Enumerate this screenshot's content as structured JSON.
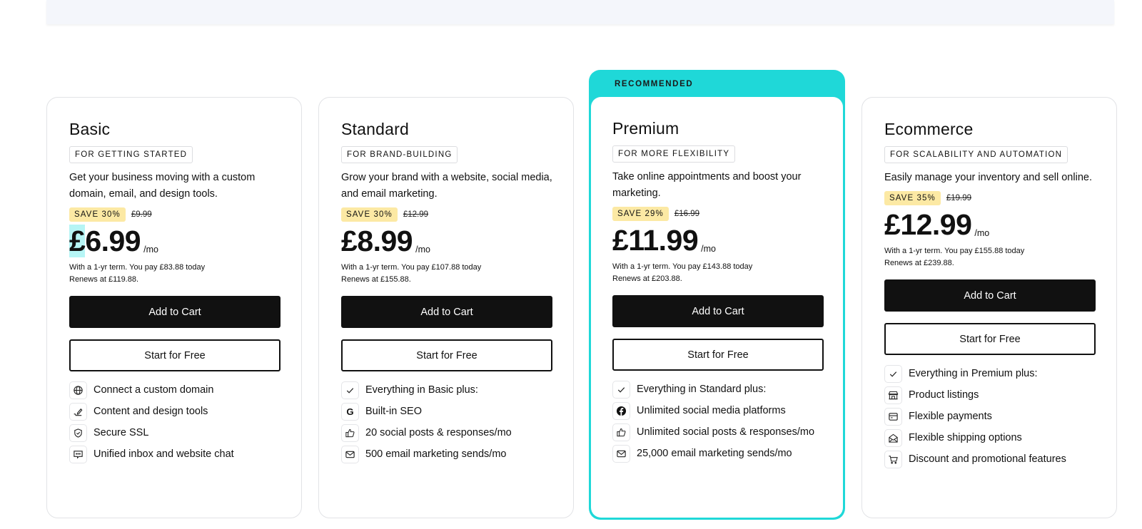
{
  "colors": {
    "recommended_accent": "#1fd8d8",
    "save_badge_bg": "#fce9a4",
    "primary_button_bg": "#111111",
    "price_highlight": "#b6f5f5"
  },
  "plans": [
    {
      "title": "Basic",
      "tag": "FOR GETTING STARTED",
      "description": "Get your business moving with a custom domain, email, and design tools.",
      "save": "SAVE 30%",
      "old_price": "£9.99",
      "price_symbol": "£",
      "price_amount": "6.99",
      "per": "/mo",
      "terms_line1": "With a 1-yr term. You pay £83.88 today",
      "terms_line2": "Renews at £119.88.",
      "add_to_cart": "Add to Cart",
      "start_free": "Start for Free",
      "features": [
        {
          "icon": "globe-icon",
          "text": "Connect a custom domain"
        },
        {
          "icon": "pen-icon",
          "text": "Content and design tools"
        },
        {
          "icon": "shield-check-icon",
          "text": "Secure SSL"
        },
        {
          "icon": "chat-icon",
          "text": "Unified inbox and website chat"
        }
      ]
    },
    {
      "title": "Standard",
      "tag": "FOR BRAND-BUILDING",
      "description": "Grow your brand with a website, social media, and email marketing.",
      "save": "SAVE 30%",
      "old_price": "£12.99",
      "price_symbol": "£",
      "price_amount": "8.99",
      "per": "/mo",
      "terms_line1": "With a 1-yr term. You pay £107.88 today",
      "terms_line2": "Renews at £155.88.",
      "add_to_cart": "Add to Cart",
      "start_free": "Start for Free",
      "features": [
        {
          "icon": "check-icon",
          "text": "Everything in Basic plus:"
        },
        {
          "icon": "google-icon",
          "text": "Built-in SEO"
        },
        {
          "icon": "thumbs-up-icon",
          "text": "20 social posts & responses/mo"
        },
        {
          "icon": "mail-icon",
          "text": "500 email marketing sends/mo"
        }
      ]
    },
    {
      "recommended_label": "RECOMMENDED",
      "title": "Premium",
      "tag": "FOR MORE FLEXIBILITY",
      "description": "Take online appointments and boost your marketing.",
      "save": "SAVE 29%",
      "old_price": "£16.99",
      "price_symbol": "£",
      "price_amount": "11.99",
      "per": "/mo",
      "terms_line1": "With a 1-yr term. You pay £143.88 today",
      "terms_line2": "Renews at £203.88.",
      "add_to_cart": "Add to Cart",
      "start_free": "Start for Free",
      "features": [
        {
          "icon": "check-icon",
          "text": "Everything in Standard plus:"
        },
        {
          "icon": "facebook-icon",
          "text": "Unlimited social media platforms"
        },
        {
          "icon": "thumbs-up-icon",
          "text": "Unlimited social posts & responses/mo"
        },
        {
          "icon": "mail-icon",
          "text": "25,000 email marketing sends/mo"
        }
      ]
    },
    {
      "title": "Ecommerce",
      "tag": "FOR SCALABILITY AND AUTOMATION",
      "description": "Easily manage your inventory and sell online.",
      "save": "SAVE 35%",
      "old_price": "£19.99",
      "price_symbol": "£",
      "price_amount": "12.99",
      "per": "/mo",
      "terms_line1": "With a 1-yr term. You pay £155.88 today",
      "terms_line2": "Renews at £239.88.",
      "add_to_cart": "Add to Cart",
      "start_free": "Start for Free",
      "features": [
        {
          "icon": "check-icon",
          "text": "Everything in Premium plus:"
        },
        {
          "icon": "storefront-icon",
          "text": "Product listings"
        },
        {
          "icon": "credit-card-icon",
          "text": "Flexible payments"
        },
        {
          "icon": "open-envelope-icon",
          "text": "Flexible shipping options"
        },
        {
          "icon": "cart-icon",
          "text": "Discount and promotional features"
        }
      ]
    }
  ]
}
